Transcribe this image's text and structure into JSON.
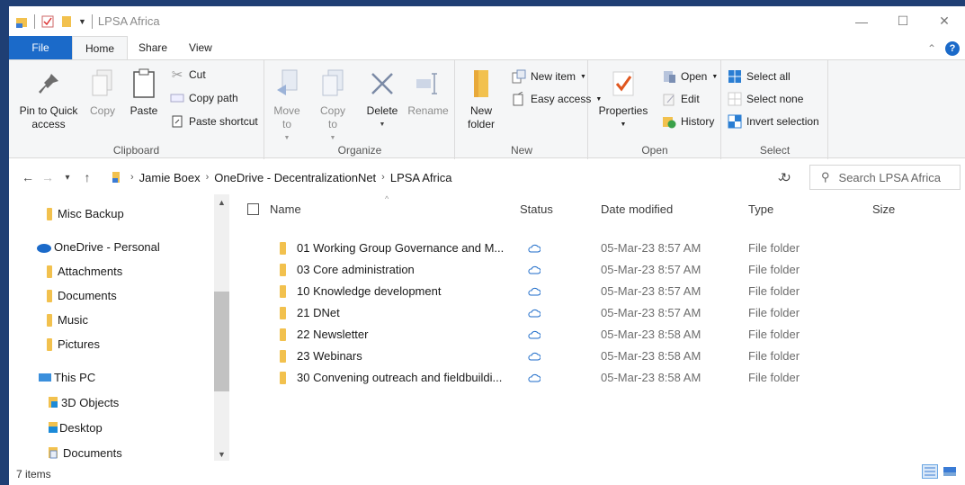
{
  "window": {
    "title": "LPSA Africa",
    "min": "—",
    "max": "☐",
    "close": "✕"
  },
  "tabs": {
    "file": "File",
    "home": "Home",
    "share": "Share",
    "view": "View"
  },
  "ribbon": {
    "clipboard": {
      "label": "Clipboard",
      "pin": "Pin to Quick access",
      "copy": "Copy",
      "paste": "Paste",
      "cut": "Cut",
      "copy_path": "Copy path",
      "paste_shortcut": "Paste shortcut"
    },
    "organize": {
      "label": "Organize",
      "move_to": "Move to",
      "copy_to": "Copy to",
      "delete": "Delete",
      "rename": "Rename"
    },
    "new": {
      "label": "New",
      "new_folder": "New folder",
      "new_item": "New item",
      "easy_access": "Easy access"
    },
    "open": {
      "label": "Open",
      "properties": "Properties",
      "open": "Open",
      "edit": "Edit",
      "history": "History"
    },
    "select": {
      "label": "Select",
      "select_all": "Select all",
      "select_none": "Select none",
      "invert": "Invert selection"
    }
  },
  "address": {
    "crumbs": [
      "Jamie Boex",
      "OneDrive - DecentralizationNet",
      "LPSA Africa"
    ],
    "search_placeholder": "Search LPSA Africa"
  },
  "nav": [
    {
      "label": "Misc Backup",
      "icon": "folder-icon"
    },
    {
      "label": "OneDrive - Personal",
      "icon": "cloud-icon"
    },
    {
      "label": "Attachments",
      "icon": "folder-icon"
    },
    {
      "label": "Documents",
      "icon": "folder-icon"
    },
    {
      "label": "Music",
      "icon": "folder-icon"
    },
    {
      "label": "Pictures",
      "icon": "folder-icon"
    },
    {
      "label": "This PC",
      "icon": "computer-icon"
    },
    {
      "label": "3D Objects",
      "icon": "3d-objects-icon"
    },
    {
      "label": "Desktop",
      "icon": "desktop-icon"
    },
    {
      "label": "Documents",
      "icon": "documents-icon"
    }
  ],
  "columns": {
    "name": "Name",
    "status": "Status",
    "date": "Date modified",
    "type": "Type",
    "size": "Size"
  },
  "files": [
    {
      "name": "01 Working Group Governance and M...",
      "date": "05-Mar-23 8:57 AM",
      "type": "File folder"
    },
    {
      "name": "03 Core administration",
      "date": "05-Mar-23 8:57 AM",
      "type": "File folder"
    },
    {
      "name": "10 Knowledge development",
      "date": "05-Mar-23 8:57 AM",
      "type": "File folder"
    },
    {
      "name": "21 DNet",
      "date": "05-Mar-23 8:57 AM",
      "type": "File folder"
    },
    {
      "name": "22 Newsletter",
      "date": "05-Mar-23 8:58 AM",
      "type": "File folder"
    },
    {
      "name": "23 Webinars",
      "date": "05-Mar-23 8:58 AM",
      "type": "File folder"
    },
    {
      "name": "30 Convening outreach and fieldbuildi...",
      "date": "05-Mar-23 8:58 AM",
      "type": "File folder"
    }
  ],
  "status": {
    "items": "7 items"
  }
}
